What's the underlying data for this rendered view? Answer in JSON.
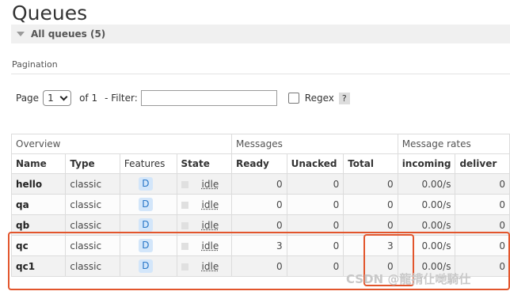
{
  "page": {
    "title": "Queues"
  },
  "section": {
    "label": "All queues (5)"
  },
  "pagination": {
    "label": "Pagination",
    "page_label": "Page",
    "page_value": "1",
    "of_label": "of 1",
    "filter_label": "- Filter:",
    "filter_value": "",
    "regex_label": "Regex",
    "help_label": "?"
  },
  "table": {
    "groups": {
      "overview": "Overview",
      "messages": "Messages",
      "rates": "Message rates"
    },
    "columns": {
      "name": "Name",
      "type": "Type",
      "features": "Features",
      "state": "State",
      "ready": "Ready",
      "unacked": "Unacked",
      "total": "Total",
      "incoming": "incoming",
      "deliver": "deliver"
    },
    "rows": [
      {
        "name": "hello",
        "type": "classic",
        "feature": "D",
        "state": "idle",
        "ready": "0",
        "unacked": "0",
        "total": "0",
        "incoming": "0.00/s",
        "deliver": "0"
      },
      {
        "name": "qa",
        "type": "classic",
        "feature": "D",
        "state": "idle",
        "ready": "0",
        "unacked": "0",
        "total": "0",
        "incoming": "0.00/s",
        "deliver": "0"
      },
      {
        "name": "qb",
        "type": "classic",
        "feature": "D",
        "state": "idle",
        "ready": "0",
        "unacked": "0",
        "total": "0",
        "incoming": "0.00/s",
        "deliver": "0"
      },
      {
        "name": "qc",
        "type": "classic",
        "feature": "D",
        "state": "idle",
        "ready": "3",
        "unacked": "0",
        "total": "3",
        "incoming": "0.00/s",
        "deliver": "0"
      },
      {
        "name": "qc1",
        "type": "classic",
        "feature": "D",
        "state": "idle",
        "ready": "0",
        "unacked": "0",
        "total": "0",
        "incoming": "0.00/s",
        "deliver": "0"
      }
    ]
  },
  "watermark": "CSDN @龍揹仩哋騎仕",
  "colors": {
    "highlight": "#e2552c",
    "badge_bg": "#d3e6fa",
    "badge_text": "#2a78c8"
  }
}
